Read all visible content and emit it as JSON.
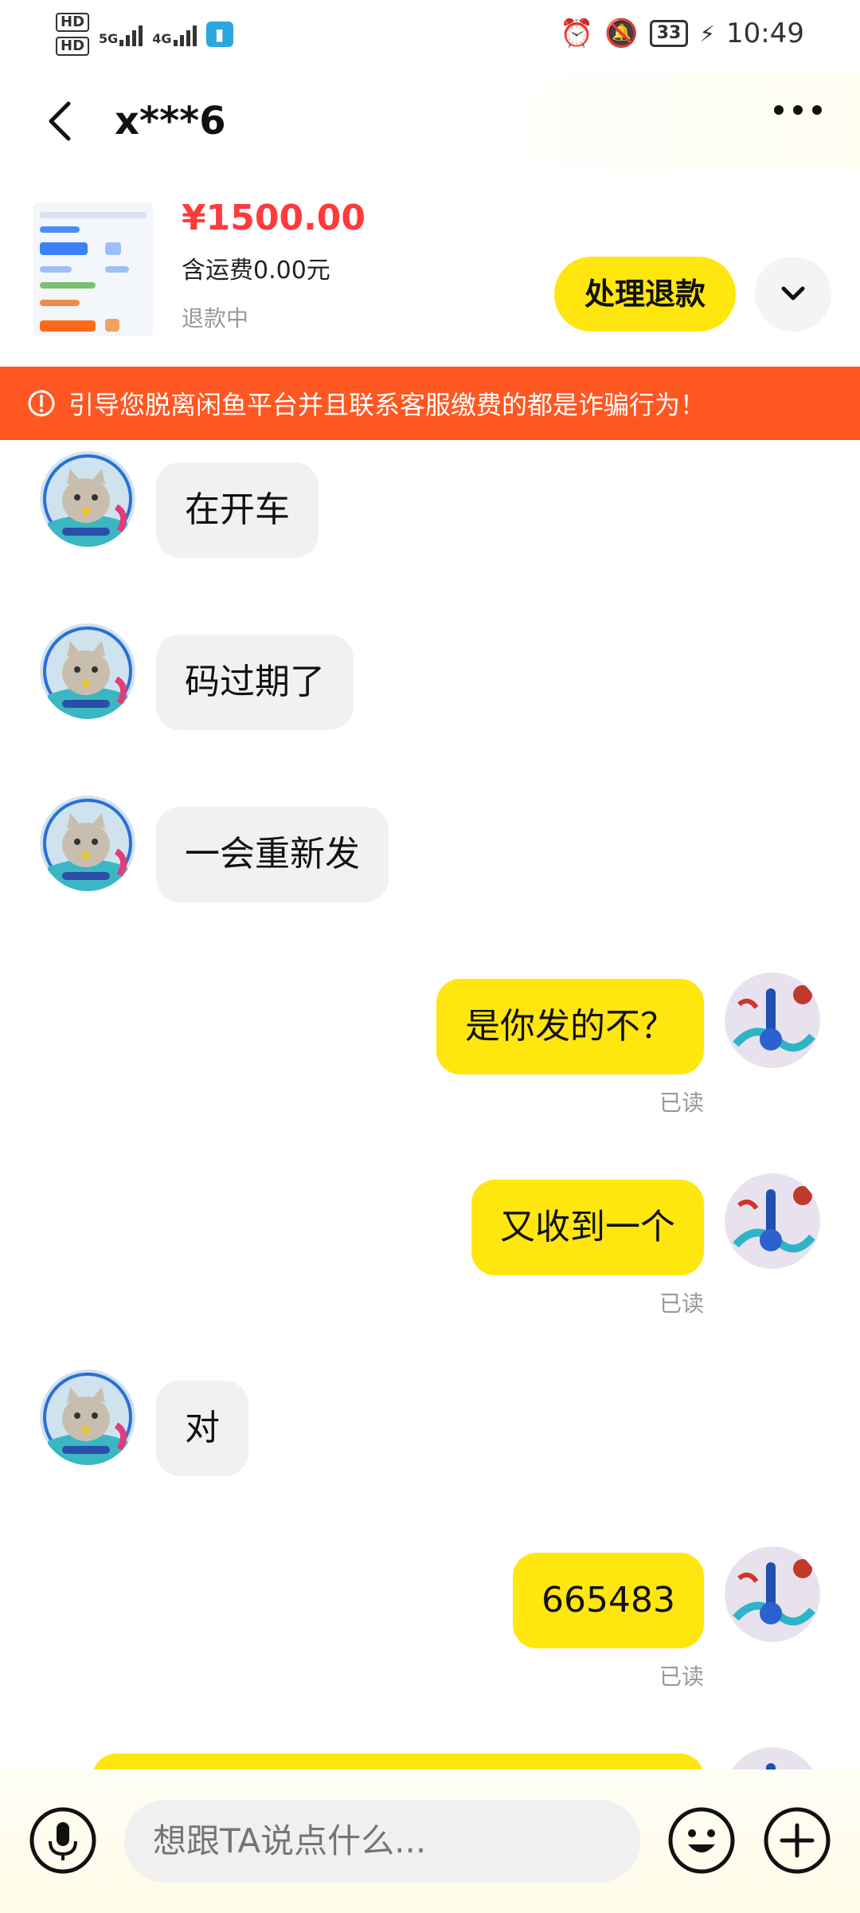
{
  "status_bar": {
    "hd1": "HD",
    "hd2": "HD",
    "net1": "5G",
    "net2": "4G",
    "battery": "33",
    "time": "10:49"
  },
  "header": {
    "title": "x***6"
  },
  "product": {
    "price": "¥1500.00",
    "shipping": "含运费0.00元",
    "status": "退款中",
    "refund_button": "处理退款"
  },
  "warning": {
    "text": "引导您脱离闲鱼平台并且联系客服缴费的都是诈骗行为！"
  },
  "messages": [
    {
      "side": "in",
      "text": "在开车"
    },
    {
      "side": "in",
      "text": "码过期了"
    },
    {
      "side": "in",
      "text": "一会重新发"
    },
    {
      "side": "out",
      "text": "是你发的不？",
      "status": "已读"
    },
    {
      "side": "out",
      "text": "又收到一个",
      "status": "已读"
    },
    {
      "side": "in",
      "text": "对"
    },
    {
      "side": "out",
      "text": "665483",
      "status": "已读"
    }
  ],
  "input": {
    "placeholder": "想跟TA说点什么..."
  },
  "colors": {
    "accent_yellow": "#ffe60f",
    "warning_orange": "#ff5722",
    "price_red": "#ff3a3a"
  }
}
